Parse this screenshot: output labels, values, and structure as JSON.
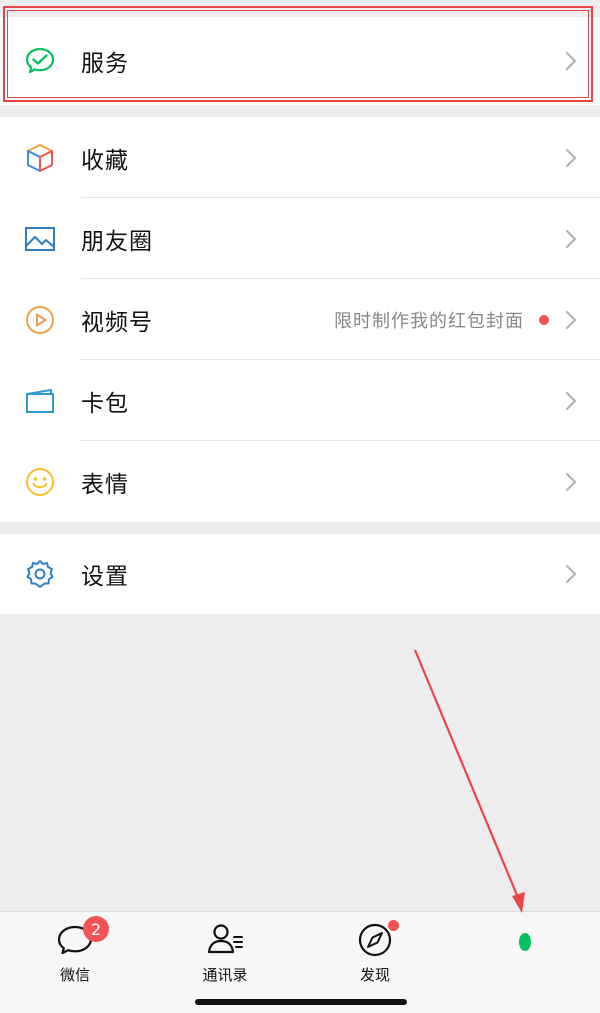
{
  "menu_groups": [
    {
      "items": [
        {
          "label": "服务",
          "icon": "wechat-pay-icon"
        }
      ]
    },
    {
      "items": [
        {
          "label": "收藏",
          "icon": "cube-icon"
        },
        {
          "label": "朋友圈",
          "icon": "image-icon"
        },
        {
          "label": "视频号",
          "icon": "play-icon",
          "extra": "限时制作我的红包封面"
        },
        {
          "label": "卡包",
          "icon": "wallet-icon"
        },
        {
          "label": "表情",
          "icon": "smiley-icon"
        }
      ]
    },
    {
      "items": [
        {
          "label": "设置",
          "icon": "gear-icon"
        }
      ]
    }
  ],
  "tabbar": {
    "tabs": [
      {
        "label": "微信",
        "badge": "2",
        "icon": "chat-icon"
      },
      {
        "label": "通讯录",
        "icon": "contacts-icon"
      },
      {
        "label": "发现",
        "icon": "compass-icon"
      },
      {
        "label": "",
        "icon": "me-icon"
      }
    ]
  },
  "colors": {
    "accent_green": "#07c160",
    "annotation_red": "#e8454a",
    "badge_red": "#f25353"
  }
}
